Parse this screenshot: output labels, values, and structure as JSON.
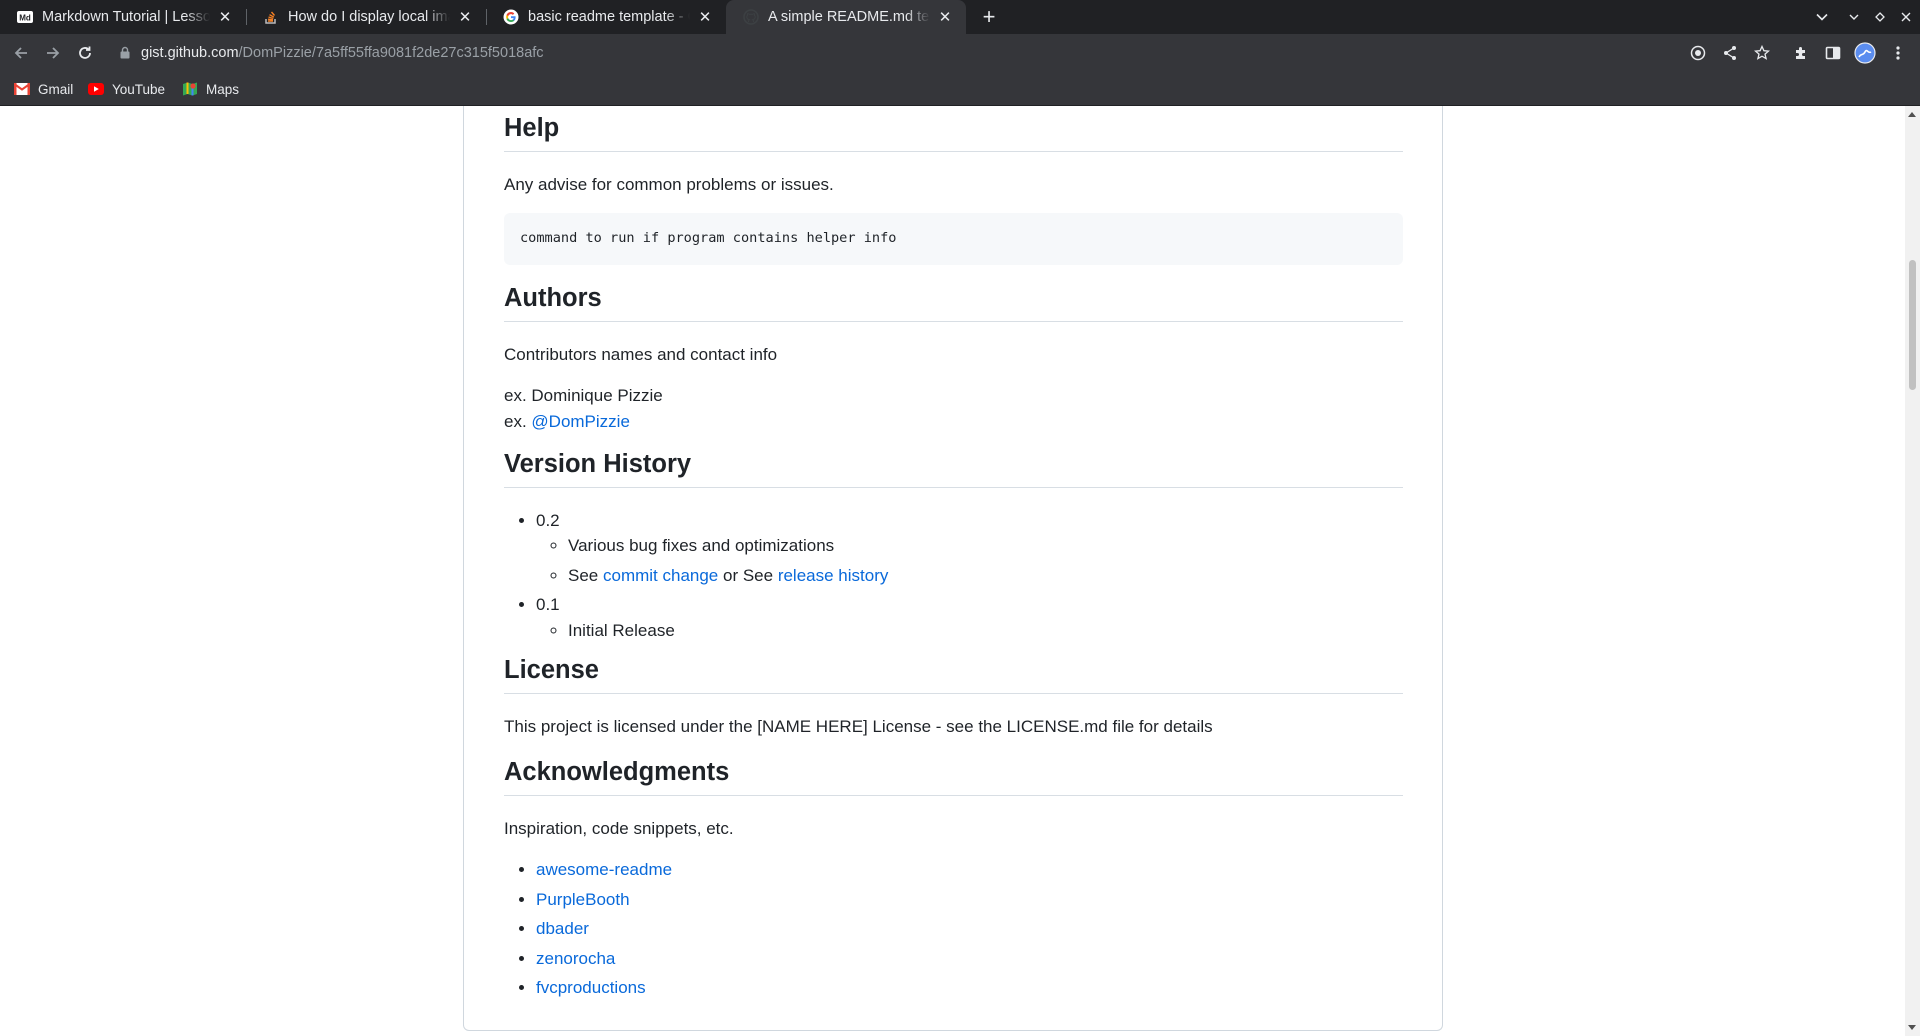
{
  "browser": {
    "tabs": [
      {
        "title": "Markdown Tutorial | Lesson",
        "icon": "markdown-icon"
      },
      {
        "title": "How do I display local image",
        "icon": "stackoverflow-icon"
      },
      {
        "title": "basic readme template - Goo",
        "icon": "google-icon"
      },
      {
        "title": "A simple README.md template",
        "icon": "github-icon",
        "active": true
      }
    ],
    "url_host": "gist.github.com",
    "url_path": "/DomPizzie/7a5ff55ffa9081f2de27c315f5018afc",
    "bookmarks": [
      {
        "label": "Gmail",
        "icon": "gmail-icon"
      },
      {
        "label": "YouTube",
        "icon": "youtube-icon"
      },
      {
        "label": "Maps",
        "icon": "maps-icon"
      }
    ],
    "colors": {
      "tabbar": "#202124",
      "toolbar": "#35363a",
      "link": "#0969da"
    }
  },
  "readme": {
    "help": {
      "heading": "Help",
      "text": "Any advise for common problems or issues.",
      "code": "command to run if program contains helper info"
    },
    "authors": {
      "heading": "Authors",
      "text": "Contributors names and contact info",
      "line1": "ex. Dominique Pizzie",
      "line2_prefix": "ex. ",
      "line2_link": "@DomPizzie"
    },
    "version_history": {
      "heading": "Version History",
      "v02": "0.2",
      "v02_item1": "Various bug fixes and optimizations",
      "v02_item2_prefix": "See ",
      "v02_item2_link1": "commit change",
      "v02_item2_mid": " or See ",
      "v02_item2_link2": "release history",
      "v01": "0.1",
      "v01_item1": "Initial Release"
    },
    "license": {
      "heading": "License",
      "text": "This project is licensed under the [NAME HERE] License - see the LICENSE.md file for details"
    },
    "acknowledgments": {
      "heading": "Acknowledgments",
      "text": "Inspiration, code snippets, etc.",
      "links": [
        "awesome-readme",
        "PurpleBooth",
        "dbader",
        "zenorocha",
        "fvcproductions"
      ]
    }
  }
}
